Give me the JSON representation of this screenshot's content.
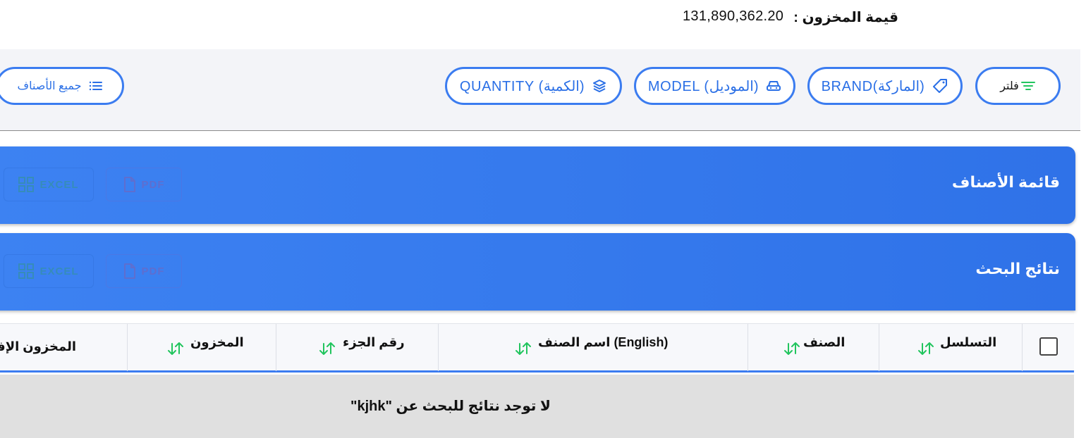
{
  "inventory": {
    "label": "قيمة المخزون :",
    "value": "131,890,362.20"
  },
  "filters": {
    "filter": "فلتر",
    "brand": "BRAND(الماركة)",
    "model": "MODEL (الموديل)",
    "quantity": "QUANTITY (الكمية)",
    "all_items": "جميع الأصناف"
  },
  "panels": {
    "items_list": {
      "title": "قائمة الأصناف",
      "pdf": "PDF",
      "excel": "EXCEL"
    },
    "search_results": {
      "title": "نتائج البحث",
      "pdf": "PDF",
      "excel": "EXCEL"
    }
  },
  "table": {
    "columns": [
      "التسلسل",
      "الصنف",
      "اسم الصنف (English)",
      "رقم الجزء",
      "المخزون",
      "المخزون الإفتتاحي"
    ]
  },
  "empty_message": "لا توجد نتائج للبحث عن \"kjhk\"",
  "colors": {
    "accent": "#3b7cf0",
    "sort_arrow": "#22c55e",
    "panel": "#3d82f2"
  }
}
